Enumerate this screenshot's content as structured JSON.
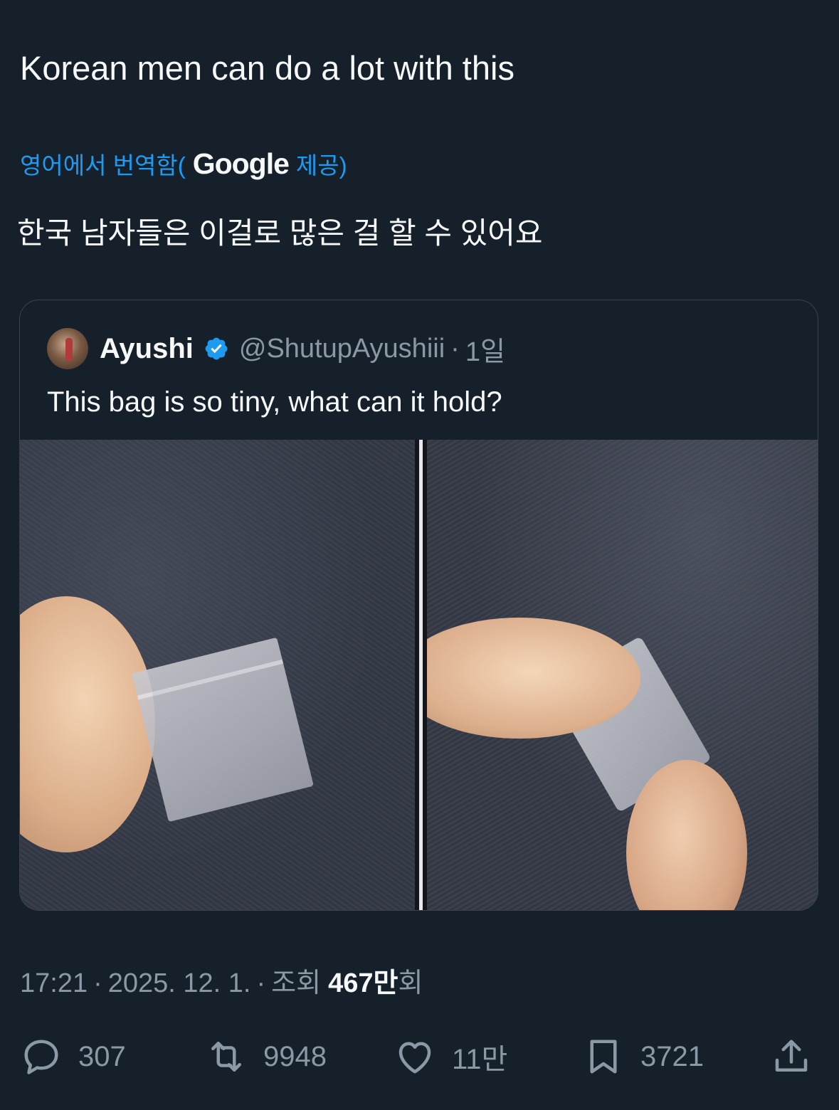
{
  "tweet": {
    "text": "Korean men can do a lot with this"
  },
  "translation": {
    "prefix": "영어에서 번역함(",
    "google": "Google",
    "suffix": "제공)",
    "translated_text": "한국 남자들은 이걸로 많은 걸 할 수 있어요"
  },
  "quote": {
    "name": "Ayushi",
    "handle": "@ShutupAyushiii",
    "separator": "·",
    "time": "1일",
    "text": "This bag is so tiny, what can it hold?",
    "verified_color": "#1d9bf0"
  },
  "meta": {
    "time": "17:21",
    "sep1": "·",
    "date": "2025. 12. 1.",
    "sep2": "·",
    "views_label": "조회",
    "views_value": "467만",
    "views_unit": "회"
  },
  "actions": {
    "reply_count": "307",
    "retweet_count": "9948",
    "like_count": "11만",
    "bookmark_count": "3721"
  },
  "icons": [
    "reply-icon",
    "retweet-icon",
    "like-icon",
    "bookmark-icon",
    "share-icon",
    "verified-icon"
  ],
  "colors": {
    "background": "#15202b",
    "accent": "#1d9bf0",
    "muted": "#8b98a5",
    "text": "#f7f9f9",
    "border": "#38444d"
  }
}
